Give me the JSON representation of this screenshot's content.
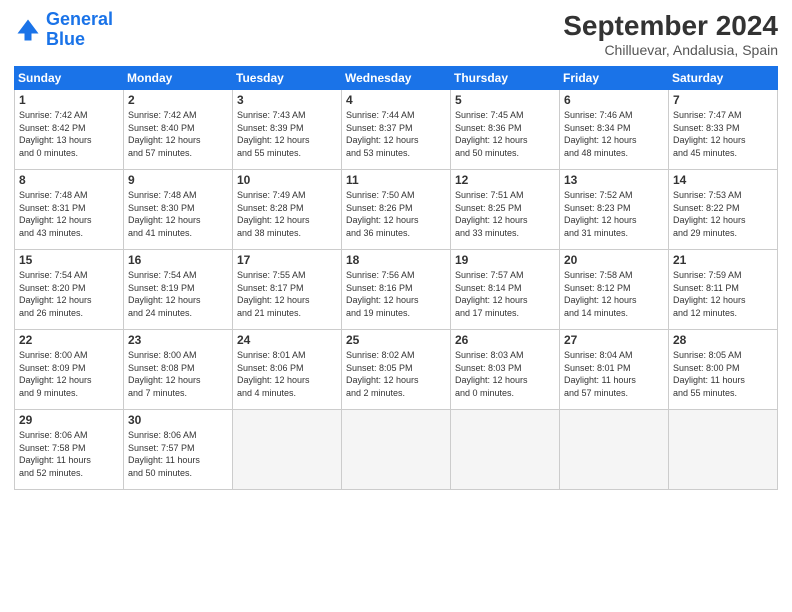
{
  "header": {
    "logo_line1": "General",
    "logo_line2": "Blue",
    "title": "September 2024",
    "subtitle": "Chilluevar, Andalusia, Spain"
  },
  "weekdays": [
    "Sunday",
    "Monday",
    "Tuesday",
    "Wednesday",
    "Thursday",
    "Friday",
    "Saturday"
  ],
  "weeks": [
    [
      {
        "day": "1",
        "info": "Sunrise: 7:42 AM\nSunset: 8:42 PM\nDaylight: 13 hours\nand 0 minutes."
      },
      {
        "day": "2",
        "info": "Sunrise: 7:42 AM\nSunset: 8:40 PM\nDaylight: 12 hours\nand 57 minutes."
      },
      {
        "day": "3",
        "info": "Sunrise: 7:43 AM\nSunset: 8:39 PM\nDaylight: 12 hours\nand 55 minutes."
      },
      {
        "day": "4",
        "info": "Sunrise: 7:44 AM\nSunset: 8:37 PM\nDaylight: 12 hours\nand 53 minutes."
      },
      {
        "day": "5",
        "info": "Sunrise: 7:45 AM\nSunset: 8:36 PM\nDaylight: 12 hours\nand 50 minutes."
      },
      {
        "day": "6",
        "info": "Sunrise: 7:46 AM\nSunset: 8:34 PM\nDaylight: 12 hours\nand 48 minutes."
      },
      {
        "day": "7",
        "info": "Sunrise: 7:47 AM\nSunset: 8:33 PM\nDaylight: 12 hours\nand 45 minutes."
      }
    ],
    [
      {
        "day": "8",
        "info": "Sunrise: 7:48 AM\nSunset: 8:31 PM\nDaylight: 12 hours\nand 43 minutes."
      },
      {
        "day": "9",
        "info": "Sunrise: 7:48 AM\nSunset: 8:30 PM\nDaylight: 12 hours\nand 41 minutes."
      },
      {
        "day": "10",
        "info": "Sunrise: 7:49 AM\nSunset: 8:28 PM\nDaylight: 12 hours\nand 38 minutes."
      },
      {
        "day": "11",
        "info": "Sunrise: 7:50 AM\nSunset: 8:26 PM\nDaylight: 12 hours\nand 36 minutes."
      },
      {
        "day": "12",
        "info": "Sunrise: 7:51 AM\nSunset: 8:25 PM\nDaylight: 12 hours\nand 33 minutes."
      },
      {
        "day": "13",
        "info": "Sunrise: 7:52 AM\nSunset: 8:23 PM\nDaylight: 12 hours\nand 31 minutes."
      },
      {
        "day": "14",
        "info": "Sunrise: 7:53 AM\nSunset: 8:22 PM\nDaylight: 12 hours\nand 29 minutes."
      }
    ],
    [
      {
        "day": "15",
        "info": "Sunrise: 7:54 AM\nSunset: 8:20 PM\nDaylight: 12 hours\nand 26 minutes."
      },
      {
        "day": "16",
        "info": "Sunrise: 7:54 AM\nSunset: 8:19 PM\nDaylight: 12 hours\nand 24 minutes."
      },
      {
        "day": "17",
        "info": "Sunrise: 7:55 AM\nSunset: 8:17 PM\nDaylight: 12 hours\nand 21 minutes."
      },
      {
        "day": "18",
        "info": "Sunrise: 7:56 AM\nSunset: 8:16 PM\nDaylight: 12 hours\nand 19 minutes."
      },
      {
        "day": "19",
        "info": "Sunrise: 7:57 AM\nSunset: 8:14 PM\nDaylight: 12 hours\nand 17 minutes."
      },
      {
        "day": "20",
        "info": "Sunrise: 7:58 AM\nSunset: 8:12 PM\nDaylight: 12 hours\nand 14 minutes."
      },
      {
        "day": "21",
        "info": "Sunrise: 7:59 AM\nSunset: 8:11 PM\nDaylight: 12 hours\nand 12 minutes."
      }
    ],
    [
      {
        "day": "22",
        "info": "Sunrise: 8:00 AM\nSunset: 8:09 PM\nDaylight: 12 hours\nand 9 minutes."
      },
      {
        "day": "23",
        "info": "Sunrise: 8:00 AM\nSunset: 8:08 PM\nDaylight: 12 hours\nand 7 minutes."
      },
      {
        "day": "24",
        "info": "Sunrise: 8:01 AM\nSunset: 8:06 PM\nDaylight: 12 hours\nand 4 minutes."
      },
      {
        "day": "25",
        "info": "Sunrise: 8:02 AM\nSunset: 8:05 PM\nDaylight: 12 hours\nand 2 minutes."
      },
      {
        "day": "26",
        "info": "Sunrise: 8:03 AM\nSunset: 8:03 PM\nDaylight: 12 hours\nand 0 minutes."
      },
      {
        "day": "27",
        "info": "Sunrise: 8:04 AM\nSunset: 8:01 PM\nDaylight: 11 hours\nand 57 minutes."
      },
      {
        "day": "28",
        "info": "Sunrise: 8:05 AM\nSunset: 8:00 PM\nDaylight: 11 hours\nand 55 minutes."
      }
    ],
    [
      {
        "day": "29",
        "info": "Sunrise: 8:06 AM\nSunset: 7:58 PM\nDaylight: 11 hours\nand 52 minutes."
      },
      {
        "day": "30",
        "info": "Sunrise: 8:06 AM\nSunset: 7:57 PM\nDaylight: 11 hours\nand 50 minutes."
      },
      null,
      null,
      null,
      null,
      null
    ]
  ]
}
